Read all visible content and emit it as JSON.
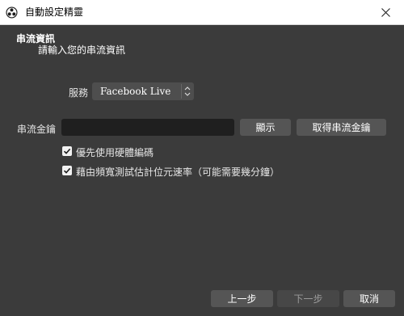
{
  "window": {
    "title": "自動設定精靈",
    "app_icon": "obs-logo-icon",
    "close_icon": "close-icon"
  },
  "header": {
    "title": "串流資訊",
    "subtitle": "請輸入您的串流資訊"
  },
  "service": {
    "label": "服務",
    "selected": "Facebook Live",
    "icon": "updown-arrows-icon"
  },
  "stream_key": {
    "label": "串流金鑰",
    "value": "",
    "show_button": "顯示",
    "get_key_button": "取得串流金鑰"
  },
  "options": [
    {
      "label": "優先使用硬體編碼",
      "checked": true
    },
    {
      "label": "藉由頻寬測試估計位元速率（可能需要幾分鐘）",
      "checked": true
    }
  ],
  "footer": {
    "back_label": "上一步",
    "next_label": "下一步",
    "next_enabled": false,
    "cancel_label": "取消"
  },
  "colors": {
    "background": "#3b3b3b",
    "button": "#555555",
    "input": "#1f1f1f"
  }
}
